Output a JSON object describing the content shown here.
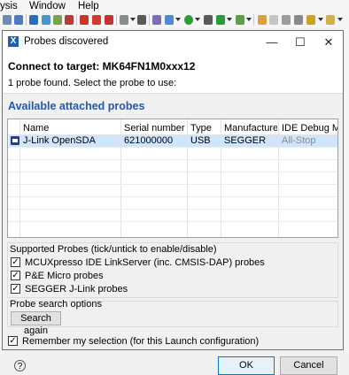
{
  "ide": {
    "menu": [
      "ysis",
      "Window",
      "Help"
    ]
  },
  "dialog": {
    "title": "Probes discovered",
    "window_buttons": {
      "minimize": "—",
      "maximize": "☐",
      "close": "✕"
    },
    "connect_title": "Connect to target: MK64FN1M0xxx12",
    "probe_message": "1 probe found. Select the probe to use:",
    "section_title": "Available attached probes",
    "table": {
      "headers": [
        "Name",
        "Serial number / I...",
        "Type",
        "Manufacturer",
        "IDE Debug Mode"
      ],
      "rows": [
        [
          "J-Link OpenSDA",
          "621000000",
          "USB",
          "SEGGER",
          "All-Stop"
        ]
      ]
    },
    "supported": {
      "title": "Supported Probes (tick/untick to enable/disable)",
      "items": [
        {
          "label": "MCUXpresso IDE LinkServer (inc. CMSIS-DAP) probes",
          "checked": true
        },
        {
          "label": "P&E Micro probes",
          "checked": true
        },
        {
          "label": "SEGGER J-Link probes",
          "checked": true
        }
      ]
    },
    "search": {
      "title": "Probe search options",
      "button": "Search again"
    },
    "remember_label": "Remember my selection (for this Launch configuration)",
    "remember_checked": true,
    "help_label": "?",
    "ok_label": "OK",
    "cancel_label": "Cancel",
    "check_mark": "✓"
  },
  "colors": {
    "accent": "#2459a6",
    "selection": "#cfe5fb",
    "ok_border": "#0078d7"
  }
}
